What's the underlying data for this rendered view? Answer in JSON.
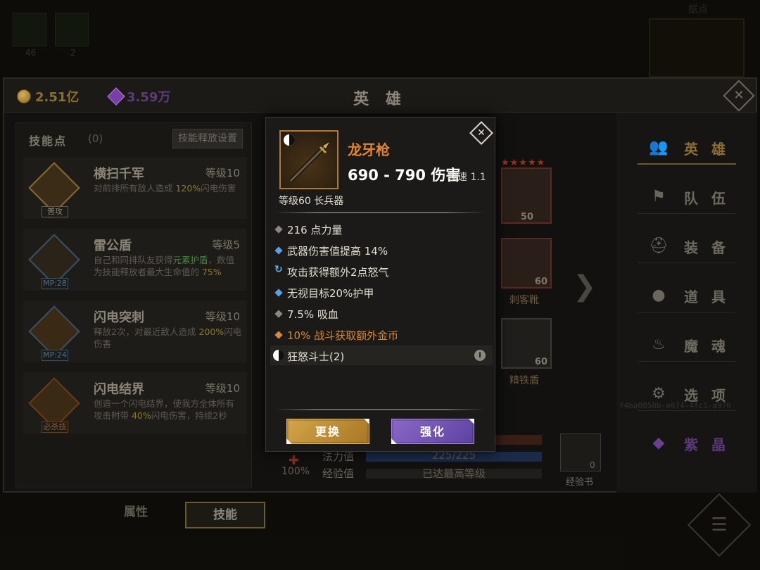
{
  "world": {
    "top_icons": [
      {
        "count": "46"
      },
      {
        "count": "2"
      }
    ],
    "map_label": "据点"
  },
  "hero_window": {
    "title": "英 雄",
    "currency": {
      "gold": "2.51亿",
      "gems": "3.59万"
    }
  },
  "skills": {
    "points_label": "技能点",
    "points_value": "(0)",
    "release_settings": "技能释放设置",
    "items": [
      {
        "name": "横扫千军",
        "level": "等级10",
        "tag": "普攻",
        "desc_pre": "对前排所有敌人造成 ",
        "desc_hl": "120%",
        "desc_post": "闪电伤害"
      },
      {
        "name": "雷公盾",
        "level": "等级5",
        "tag": "MP:28",
        "desc_pre": "自己和同排队友获得",
        "desc_hl": "元素护盾",
        "desc_mid": "，数值为技能释放者最大生命值的 ",
        "desc_hl2": "75%",
        "desc_post": ""
      },
      {
        "name": "闪电突刺",
        "level": "等级10",
        "tag": "MP:24",
        "desc_pre": "释放2次，对最近敌人造成 ",
        "desc_hl": "200%",
        "desc_post": "闪电伤害"
      },
      {
        "name": "闪电结界",
        "level": "等级10",
        "tag": "必杀技",
        "desc_pre": "创造一个闪电结界，使我方全体所有攻击附带 ",
        "desc_hl": "40%",
        "desc_post": "闪电伤害，持续2秒"
      }
    ],
    "tabs": {
      "attributes": "属性",
      "skills": "技能"
    }
  },
  "hero_area": {
    "portrait_level": "50",
    "equipment": [
      {
        "name": "刺客靴",
        "level": "60"
      },
      {
        "name": "精铁盾",
        "level": "60"
      }
    ],
    "partial_level": "60",
    "rage_percent": "100%",
    "mana_label": "法力值",
    "mana_value": "225/225",
    "exp_label": "经验值",
    "exp_value": "已达最高等级",
    "expbook_label": "经验书",
    "expbook_count": "0"
  },
  "nav": {
    "items": [
      {
        "label": "英 雄",
        "icon": "hero-icon"
      },
      {
        "label": "队 伍",
        "icon": "flag-icon"
      },
      {
        "label": "装 备",
        "icon": "helmet-icon"
      },
      {
        "label": "道 具",
        "icon": "bag-icon"
      },
      {
        "label": "魔 魂",
        "icon": "flame-icon"
      },
      {
        "label": "选 项",
        "icon": "gear-icon"
      },
      {
        "label": "紫 晶",
        "icon": "crystal-icon"
      }
    ],
    "hero_id": "f4ba0850b-e674-4fc1-a976"
  },
  "weapon_popup": {
    "name": "龙牙枪",
    "damage": "690 - 790 伤害",
    "speed": "攻速 1.1",
    "type": "等级60 长兵器",
    "stats": [
      {
        "text": "216 点力量",
        "bullet": "grey"
      },
      {
        "text": "武器伤害值提高 14%",
        "bullet": "blue"
      },
      {
        "text": "攻击获得额外2点怒气",
        "bullet": "cycle"
      },
      {
        "text": "无视目标20%护甲",
        "bullet": "blue"
      },
      {
        "text": "7.5% 吸血",
        "bullet": "grey"
      },
      {
        "text": "10% 战斗获取额外金币",
        "bullet": "orange"
      }
    ],
    "set_name": "狂怒斗士(2)",
    "replace_label": "更换",
    "upgrade_label": "强化"
  },
  "colors": {
    "weapon_name": "#e2852e",
    "bonus_gold": "#d8883a",
    "replace_button": "#c8963c",
    "upgrade_button": "#7455b8"
  }
}
